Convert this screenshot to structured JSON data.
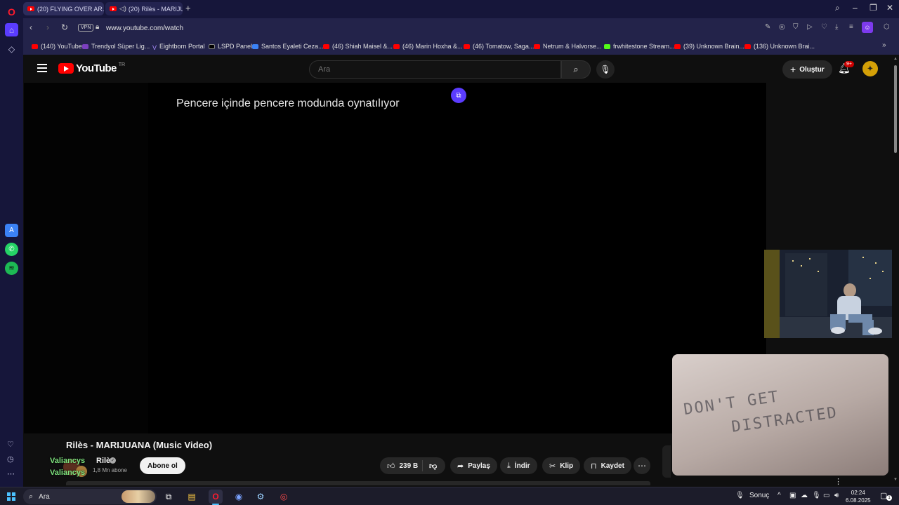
{
  "browser": {
    "tabs": [
      {
        "label": "(20) FLYING OVER AR..."
      },
      {
        "label": "(20) Rilès - MARIJUAN..."
      }
    ],
    "url": "www.youtube.com/watch",
    "vpn_label": "VPN"
  },
  "bookmarks": [
    {
      "label": "(140) YouTube"
    },
    {
      "label": "Trendyol Süper Lig..."
    },
    {
      "label": "Eightborn Portal"
    },
    {
      "label": "LSPD Panel"
    },
    {
      "label": "Santos Eyaleti Ceza..."
    },
    {
      "label": "(46) Shiah Maisel &..."
    },
    {
      "label": "(46) Marin Hoxha &..."
    },
    {
      "label": "(46) Tomatow, Saga..."
    },
    {
      "label": "Netrum & Halvorse..."
    },
    {
      "label": "frwhitestone Stream..."
    },
    {
      "label": "(39) Unknown Brain..."
    },
    {
      "label": "(136) Unknown Brai..."
    }
  ],
  "youtube": {
    "logo_text": "YouTube",
    "region": "TR",
    "search_placeholder": "Ara",
    "create_label": "Oluştur",
    "notification_count": "9+"
  },
  "player": {
    "pip_message": "Pencere içinde pencere modunda oynatılıyor"
  },
  "pip_window": {
    "text_line1": "DON'T GET",
    "text_line2": "DISTRACTED"
  },
  "video": {
    "title": "Rilès - MARIJUANA (Music Video)",
    "channel_overlay_1": "Valiancys",
    "channel_overlay_2": "Valiancys",
    "channel_name": "Rilès",
    "subscribers": "1,8 Mn abone",
    "subscribe_label": "Abone ol",
    "like_count": "239 B",
    "share_label": "Paylaş",
    "download_label": "İndir",
    "clip_label": "Klip",
    "save_label": "Kaydet"
  },
  "taskbar": {
    "search_placeholder": "Ara",
    "weather_label": "Sonuç",
    "time": "02:24",
    "date": "6.08.2025",
    "notification_count": "1"
  }
}
